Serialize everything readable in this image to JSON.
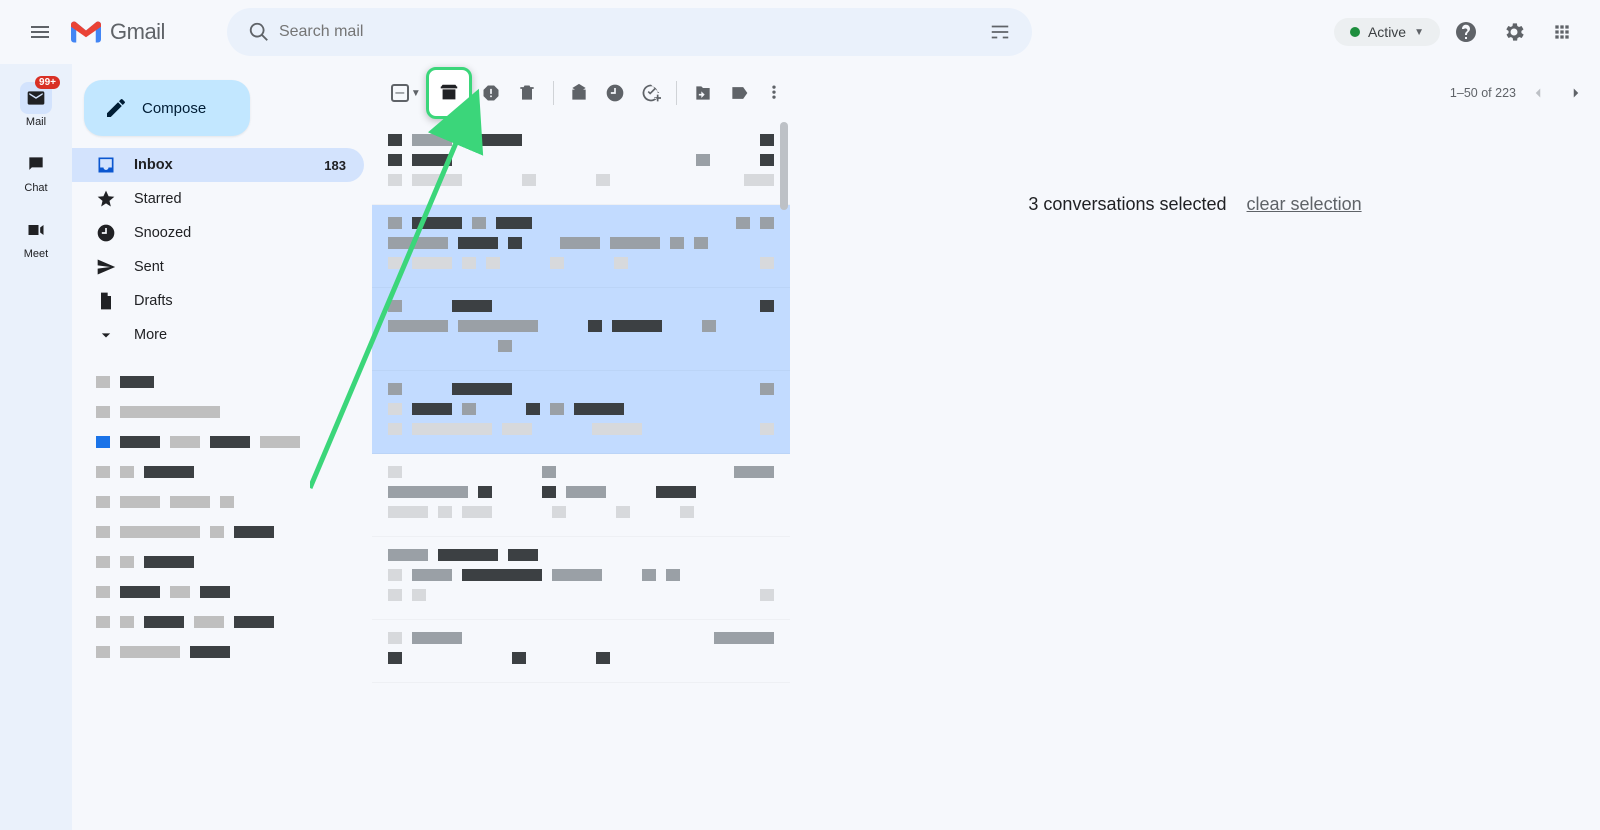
{
  "brand": "Gmail",
  "search": {
    "placeholder": "Search mail"
  },
  "status": {
    "label": "Active"
  },
  "rail": {
    "items": [
      {
        "label": "Mail",
        "badge": "99+"
      },
      {
        "label": "Chat"
      },
      {
        "label": "Meet"
      }
    ]
  },
  "compose": {
    "label": "Compose"
  },
  "sidebar": {
    "items": [
      {
        "label": "Inbox",
        "count": "183"
      },
      {
        "label": "Starred"
      },
      {
        "label": "Snoozed"
      },
      {
        "label": "Sent"
      },
      {
        "label": "Drafts"
      },
      {
        "label": "More"
      }
    ]
  },
  "pagination": {
    "range": "1–50",
    "of_word": "of",
    "total": "223"
  },
  "selection": {
    "count": "3",
    "conversations_word": "conversations selected",
    "clear_label": "clear selection"
  },
  "icons": {
    "archive": "archive",
    "report_spam": "report-spam",
    "delete": "delete",
    "mark_unread": "mark-unread",
    "snooze": "snooze",
    "add_task": "add-task",
    "move_to": "move-to",
    "labels": "labels",
    "more": "more"
  }
}
